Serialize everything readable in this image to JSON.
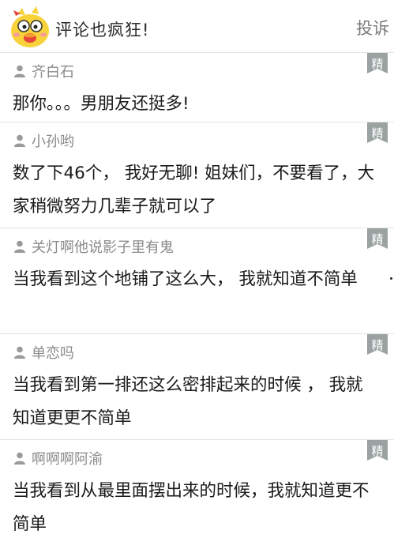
{
  "header": {
    "title": "评论也疯狂!",
    "report_label": "投诉"
  },
  "comments": [
    {
      "username": "齐白石",
      "badge": "精",
      "text": "那你。。。男朋友还挺多!"
    },
    {
      "username": "小孙哟",
      "badge": "精",
      "text": "数了下46个， 我好无聊! 姐妹们，不要看了，大家稍微努力几辈子就可以了"
    },
    {
      "username": "关灯啊他说影子里有鬼",
      "badge": "精",
      "text": "当我看到这个地铺了这么大， 我就知道不简单"
    },
    {
      "username": "单恋吗",
      "badge": "精",
      "text": "当我看到第一排还这么密排起来的时候 ， 我就知道更更不简单"
    },
    {
      "username": "啊啊啊阿渝",
      "badge": "精",
      "text": "当我看到从最里面摆出来的时候，我就知道更不简单"
    }
  ],
  "colors": {
    "badge_bg": "#9aa3a2",
    "mascot_yellow": "#f7d23a",
    "mascot_red": "#e8463b"
  },
  "icons": [
    "user-icon",
    "essence-badge-icon",
    "mascot-icon"
  ]
}
